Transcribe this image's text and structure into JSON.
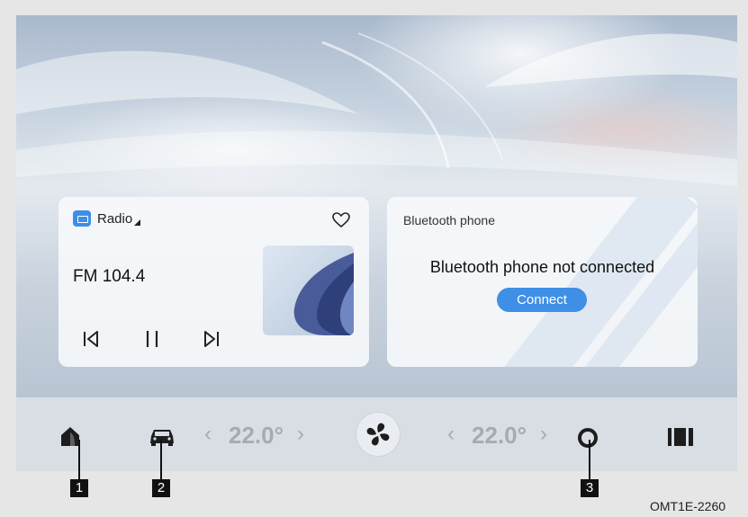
{
  "radio_card": {
    "app_label": "Radio",
    "station": "FM 104.4"
  },
  "bluetooth_card": {
    "title": "Bluetooth phone",
    "message": "Bluetooth phone not connected",
    "connect_label": "Connect"
  },
  "bottom_bar": {
    "left_temp": "22.0°",
    "right_temp": "22.0°",
    "left_arrow_prev": "‹",
    "left_arrow_next": "›",
    "right_arrow_prev": "‹",
    "right_arrow_next": "›"
  },
  "callouts": [
    "1",
    "2",
    "3"
  ],
  "figure_code": "OMT1E-2260",
  "colors": {
    "accent": "#3e8fe5",
    "temp_text": "#a6abb2",
    "bar_background": "#d9dee5"
  },
  "icons": [
    "radio-app-icon",
    "heart-icon",
    "previous-track-icon",
    "pause-icon",
    "next-track-icon",
    "home-icon",
    "car-icon",
    "fan-icon",
    "circle-icon",
    "apps-icon"
  ]
}
